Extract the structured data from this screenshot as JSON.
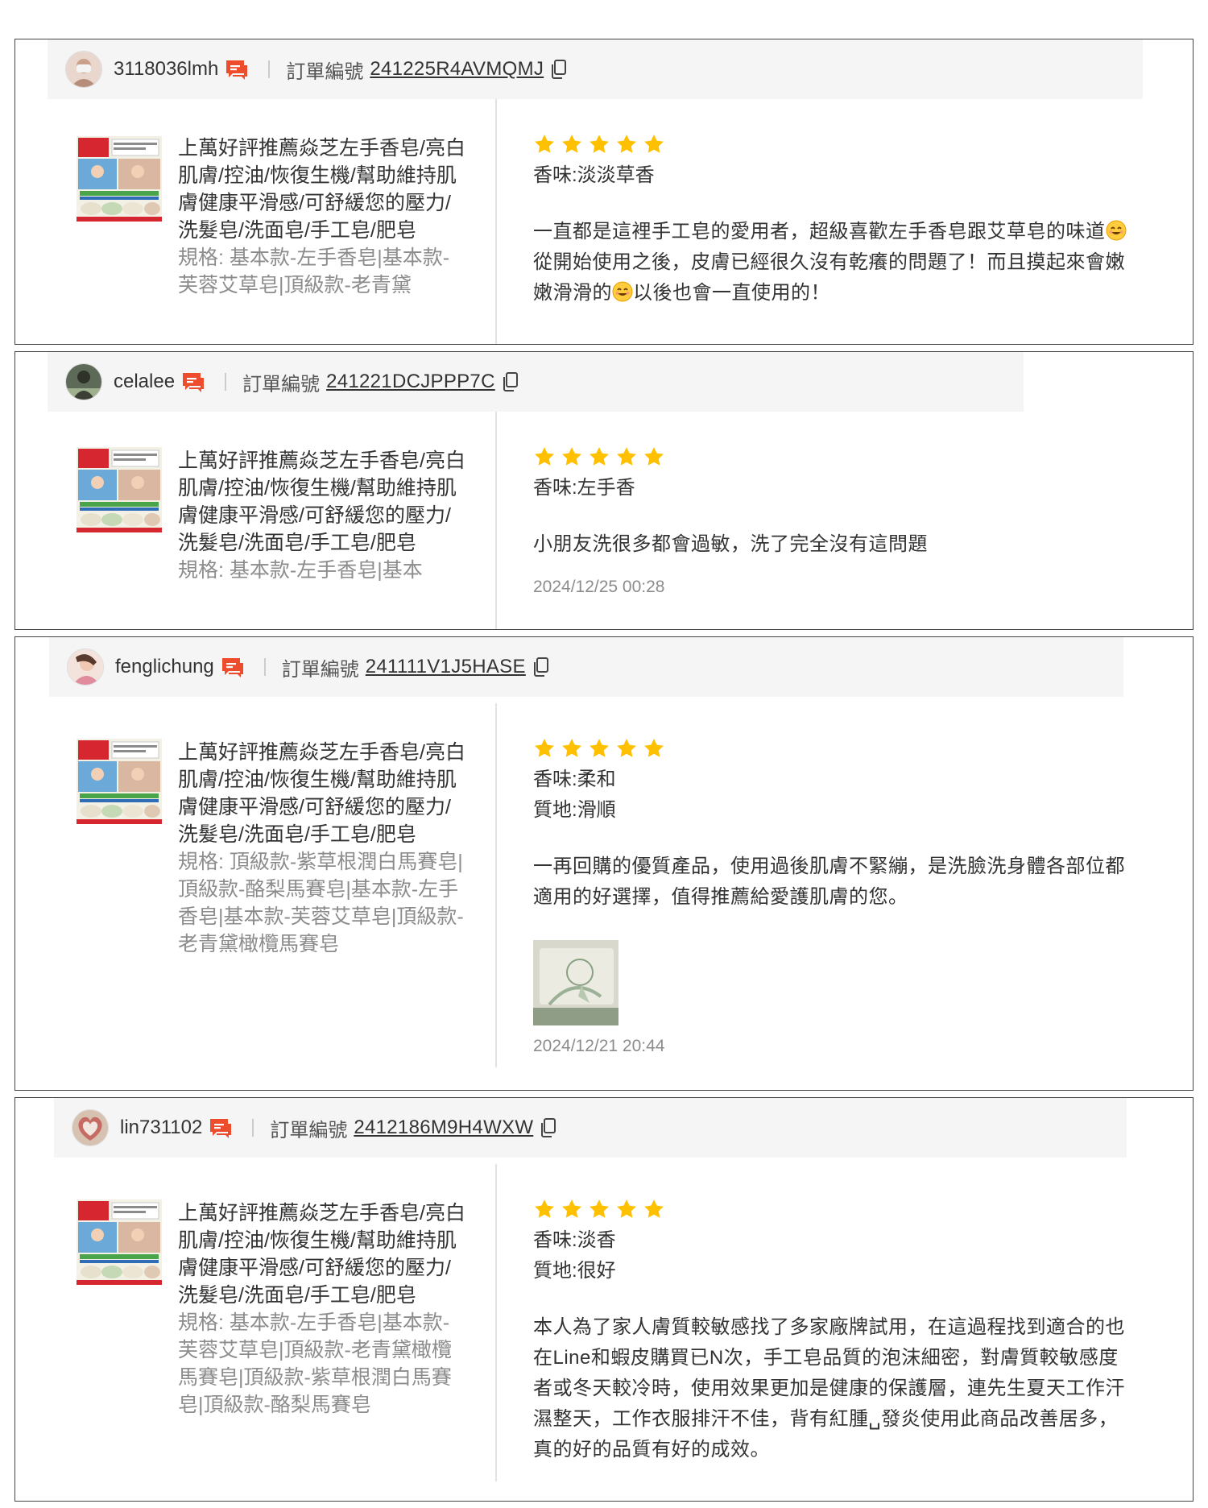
{
  "order_label": "訂單編號",
  "product": {
    "name": "上萬好評推薦焱芝左手香皂/亮白肌膚/控油/恢復生機/幫助維持肌膚健康平滑感/可舒緩您的壓力/洗髮皂/洗面皂/手工皂/肥皂",
    "thumb_banner_text": "好東西 驚喜價"
  },
  "colors": {
    "star": "#ffc000",
    "chat_icon": "#ee4d2d",
    "header_bg": "#f5f5f5"
  },
  "reviews": [
    {
      "username": "3118036lmh",
      "order_no": "241225R4AVMQMJ",
      "spec": "規格: 基本款-左手香皂|基本款-芙蓉艾草皂|頂級款-老青黛",
      "rating": 5,
      "attributes": [
        "香味:淡淡草香"
      ],
      "comment_1": "一直都是這裡手工皂的愛用者，超級喜歡左手香皂跟艾草皂的味道",
      "comment_2": "從開始使用之後，皮膚已經很久沒有乾癢的問題了！而且摸起來會嫩嫩滑滑的",
      "comment_3": "以後也會一直使用的！"
    },
    {
      "username": "celalee",
      "order_no": "241221DCJPPP7C",
      "spec": "規格: 基本款-左手香皂|基本",
      "rating": 5,
      "attributes": [
        "香味:左手香"
      ],
      "comment": "小朋友洗很多都會過敏，洗了完全沒有這問題",
      "date": "2024/12/25 00:28"
    },
    {
      "username": "fenglichung",
      "order_no": "241111V1J5HASE",
      "spec": "規格: 頂級款-紫草根潤白馬賽皂|頂級款-酪梨馬賽皂|基本款-左手香皂|基本款-芙蓉艾草皂|頂級款-老青黛橄欖馬賽皂",
      "rating": 5,
      "attributes": [
        "香味:柔和",
        "質地:滑順"
      ],
      "comment": "一再回購的優質產品，使用過後肌膚不緊繃，是洗臉洗身體各部位都適用的好選擇，值得推薦給愛護肌膚的您。",
      "date": "2024/12/21 20:44"
    },
    {
      "username": "lin731102",
      "order_no": "2412186M9H4WXW",
      "spec": "規格: 基本款-左手香皂|基本款-芙蓉艾草皂|頂級款-老青黛橄欖馬賽皂|頂級款-紫草根潤白馬賽皂|頂級款-酪梨馬賽皂",
      "rating": 5,
      "attributes": [
        "香味:淡香",
        "質地:很好"
      ],
      "comment": "本人為了家人膚質較敏感找了多家廠牌試用，在這過程找到適合的也在Line和蝦皮購買已N次，手工皂品質的泡沫細密，對膚質較敏感度者或冬天較冷時，使用效果更加是健康的保護層，連先生夏天工作汗濕整天，工作衣服排汗不佳，背有紅腫␣發炎使用此商品改善居多，真的好的品質有好的成效。"
    }
  ]
}
